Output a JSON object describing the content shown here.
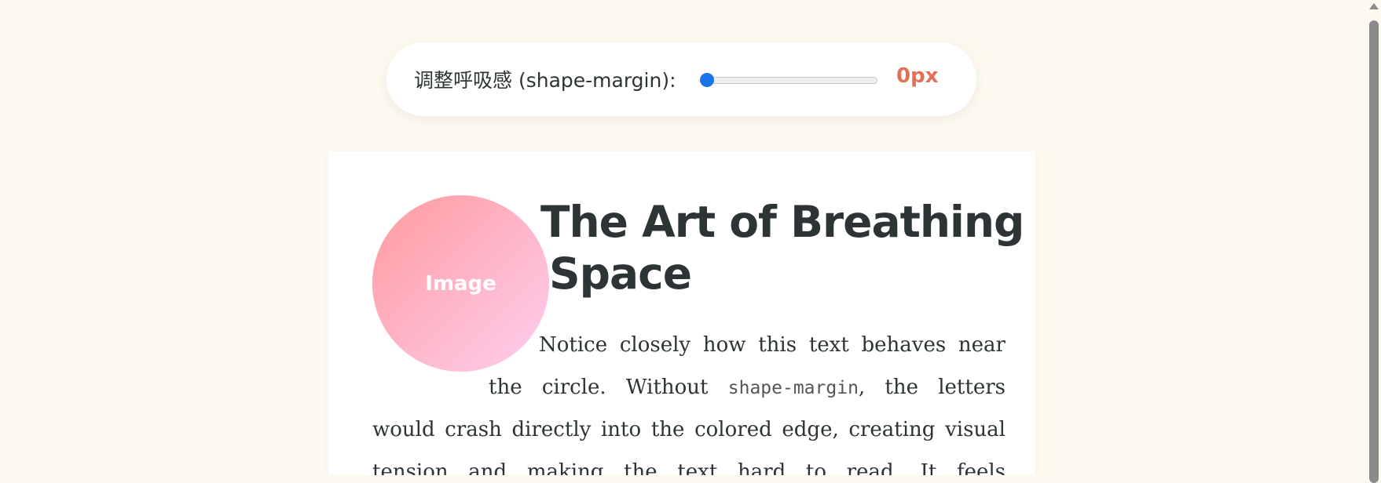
{
  "controls": {
    "label": "调整呼吸感 (shape-margin):",
    "slider_value": 0,
    "slider_min": 0,
    "value_display": "0px"
  },
  "article": {
    "image_label": "Image",
    "title_line1": "The Art of Breathing",
    "title_line2": "Space",
    "body": {
      "line1": "Notice closely how this text behaves near",
      "line2_before": "the circle. Without ",
      "line2_code": "shape-margin",
      "line2_after": ", the letters",
      "line3": "would crash directly into the colored edge, creating visual",
      "line4": "tension and making the text hard to read. It feels"
    }
  },
  "colors": {
    "page_bg": "#fef9ee",
    "accent_value": "#e17055",
    "slider_thumb": "#1a73e8",
    "circle_gradient_start": "#ff9a9e",
    "circle_gradient_end": "#fecfef",
    "text": "#2d3436"
  },
  "icons": {
    "scroll_up": "triangle-up-icon"
  }
}
